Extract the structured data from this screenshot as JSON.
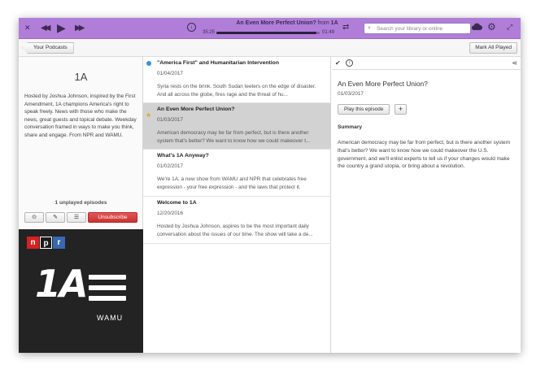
{
  "header": {
    "now_playing_title": "An Even More Perfect Union?",
    "now_playing_from": " from ",
    "now_playing_show": "1A",
    "elapsed": "35:25",
    "total": "01:49",
    "progress": 0.97,
    "search_placeholder": "Search your library or online",
    "colors": {
      "bar": "#b07ed9"
    }
  },
  "toolbar": {
    "back_label": "Your Podcasts",
    "mark_all_label": "Mark All Played"
  },
  "podcast": {
    "name": "1A",
    "description": "Hosted by Joshua Johnson, inspired by the First Amendment, 1A champions America's right to speak freely. News with those who make the news, great guests and topical debate. Weekday conversation framed in ways to make you think, share and engage. From NPR and WAMU.",
    "unplayed": "1 unplayed episodes",
    "unsubscribe_label": "Unsubscribe",
    "art": {
      "npr_n": "n",
      "npr_p": "p",
      "npr_r": "r",
      "logo": "1A",
      "station": "WAMU"
    }
  },
  "episodes": [
    {
      "title": "\"America First\" and Humanitarian Intervention",
      "date": "01/04/2017",
      "desc": "Syria rests on the brink. South Sudan teeters on the edge of disaster. And all across the globe, fires rage and the threat of hu..."
    },
    {
      "title": "An Even More Perfect Union?",
      "date": "01/03/2017",
      "desc": "American democracy may be far from perfect, but is there another system that's better? We want to know how we could makeover t..."
    },
    {
      "title": "What's 1A Anyway?",
      "date": "01/02/2017",
      "desc": "We're 1A, a new show from WAMU and NPR that celebrates free expression - your free expression - and the laws that protect it."
    },
    {
      "title": "Welcome to 1A",
      "date": "12/20/2016",
      "desc": "Hosted by Joshua Johnson, aspires to be the most important daily conversation about the issues of our time. The show will take a de..."
    }
  ],
  "detail": {
    "title": "An Even More Perfect Union?",
    "date": "01/03/2017",
    "play_label": "Play this episode",
    "add_label": "+",
    "summary_heading": "Summary",
    "summary": "American democracy may be far from perfect, but is there another system that's better? We want to know how we could makeover the U.S. government, and we'll enlist experts to tell us if your changes would make the country a grand utopia, or bring about a revolution."
  }
}
